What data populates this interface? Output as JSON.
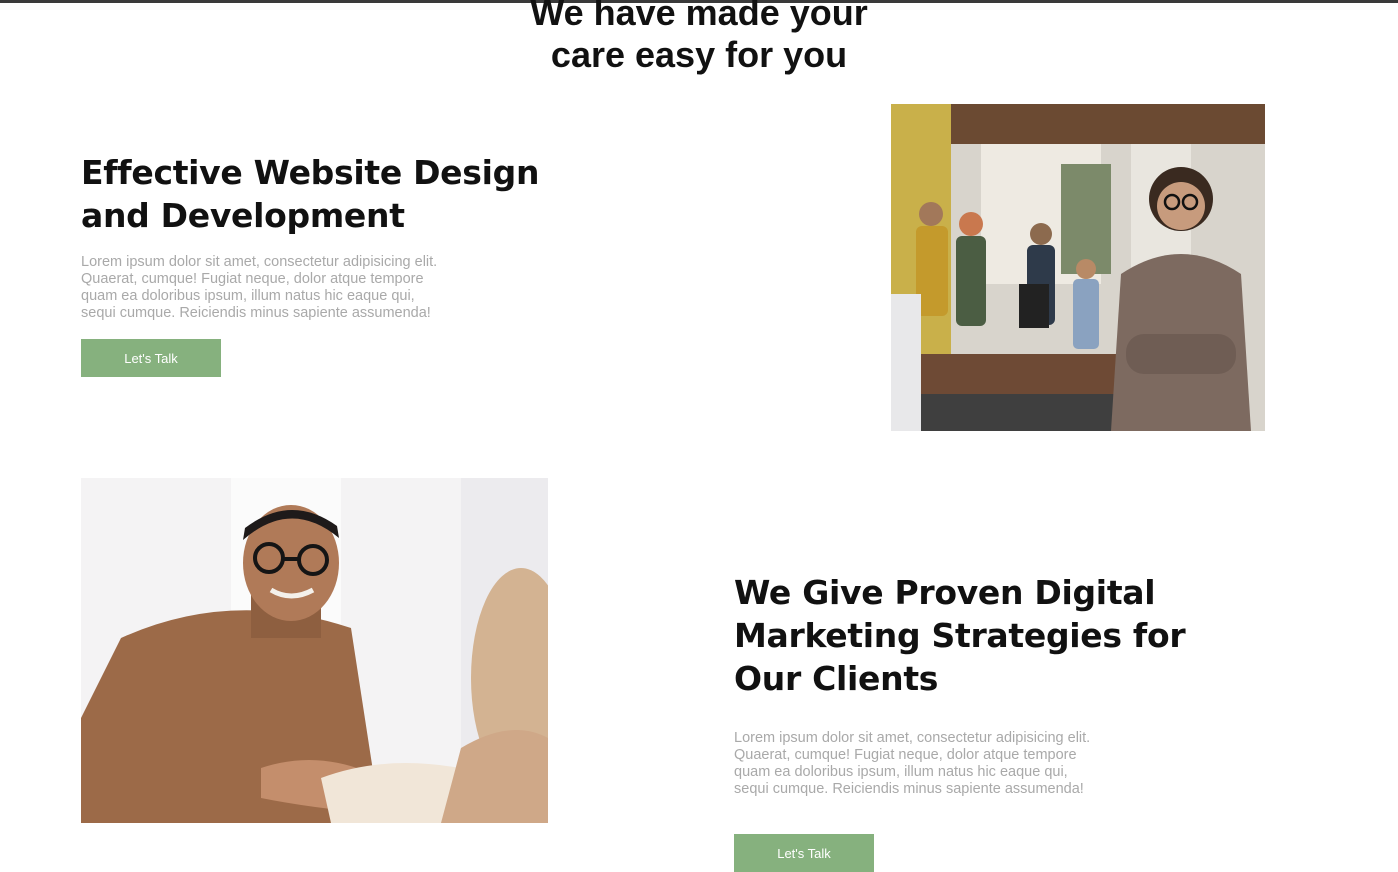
{
  "header": {
    "title_lines": [
      "We have made your",
      "care easy for you"
    ]
  },
  "features": [
    {
      "heading_lines": [
        "Effective Website Design",
        "and Development"
      ],
      "text_lines": [
        "Lorem ipsum dolor sit amet, consectetur adipisicing elit.",
        "Quaerat, cumque! Fugiat neque, dolor atque tempore",
        "quam ea doloribus ipsum, illum natus hic eaque qui,",
        "sequi cumque. Reiciendis minus sapiente assumenda!"
      ],
      "button_label": "Let's Talk"
    },
    {
      "heading_lines": [
        "We Give Proven Digital",
        "Marketing Strategies for",
        "Our Clients"
      ],
      "text_lines": [
        "Lorem ipsum dolor sit amet, consectetur adipisicing elit.",
        "Quaerat, cumque! Fugiat neque, dolor atque tempore",
        "quam ea doloribus ipsum, illum natus hic eaque qui,",
        "sequi cumque. Reiciendis minus sapiente assumenda!"
      ],
      "button_label": "Let's Talk"
    }
  ],
  "colors": {
    "accent": "#86b17e",
    "heading": "#111111",
    "body_text": "#a9a9a9"
  }
}
